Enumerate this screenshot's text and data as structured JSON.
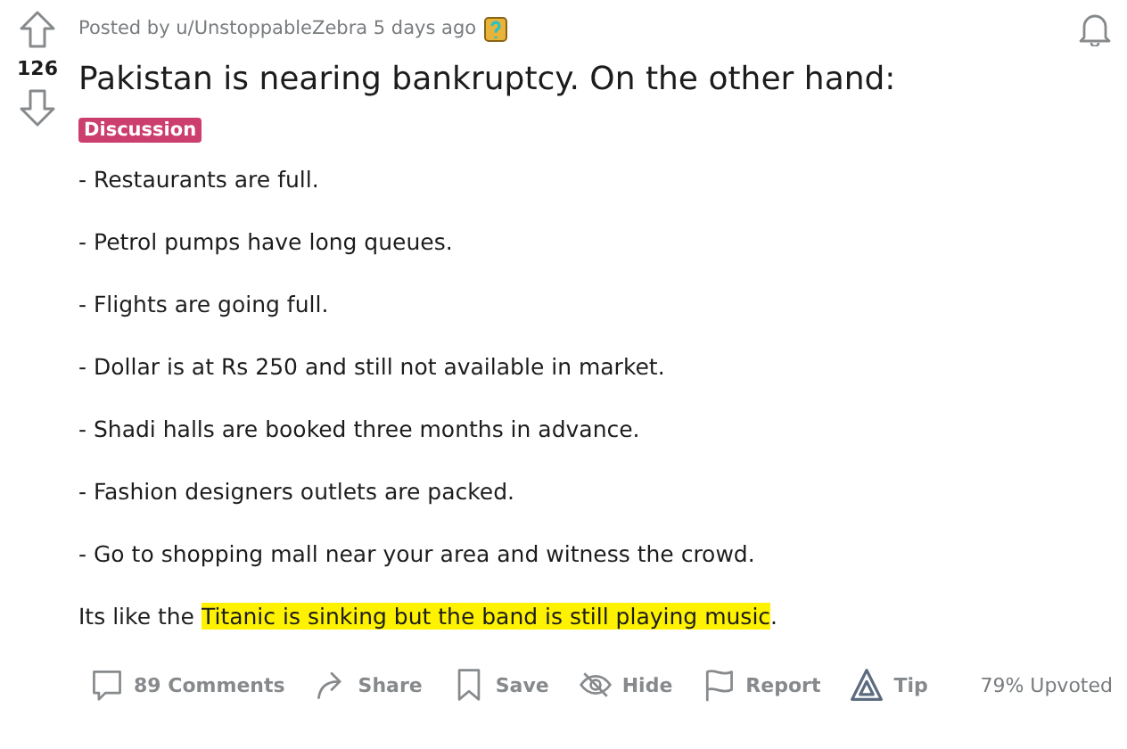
{
  "post": {
    "meta": "Posted by u/UnstoppableZebra 5 days ago",
    "votes": "126",
    "title": "Pakistan is nearing bankruptcy. On the other hand:",
    "flair": "Discussion",
    "paragraphs": [
      {
        "segments": [
          {
            "text": "- Restaurants are full.",
            "highlighted": false
          }
        ]
      },
      {
        "segments": [
          {
            "text": "- Petrol pumps have long queues.",
            "highlighted": false
          }
        ]
      },
      {
        "segments": [
          {
            "text": "- Flights are going full.",
            "highlighted": false
          }
        ]
      },
      {
        "segments": [
          {
            "text": "- Dollar is at Rs 250 and still not available in market.",
            "highlighted": false
          }
        ]
      },
      {
        "segments": [
          {
            "text": "- Shadi halls are booked three months in advance.",
            "highlighted": false
          }
        ]
      },
      {
        "segments": [
          {
            "text": "- Fashion designers outlets are packed.",
            "highlighted": false
          }
        ]
      },
      {
        "segments": [
          {
            "text": "- Go to shopping mall near your area and witness the crowd.",
            "highlighted": false
          }
        ]
      },
      {
        "segments": [
          {
            "text": "Its like the ",
            "highlighted": false
          },
          {
            "text": "Titanic is sinking but the band is still playing music",
            "highlighted": true
          },
          {
            "text": ".",
            "highlighted": false
          }
        ]
      }
    ],
    "actions": [
      {
        "kind": "comments",
        "label": "89 Comments"
      },
      {
        "kind": "share",
        "label": "Share"
      },
      {
        "kind": "save",
        "label": "Save"
      },
      {
        "kind": "hide",
        "label": "Hide"
      },
      {
        "kind": "report",
        "label": "Report"
      },
      {
        "kind": "tip",
        "label": "Tip"
      }
    ],
    "upvoted": "79% Upvoted"
  }
}
